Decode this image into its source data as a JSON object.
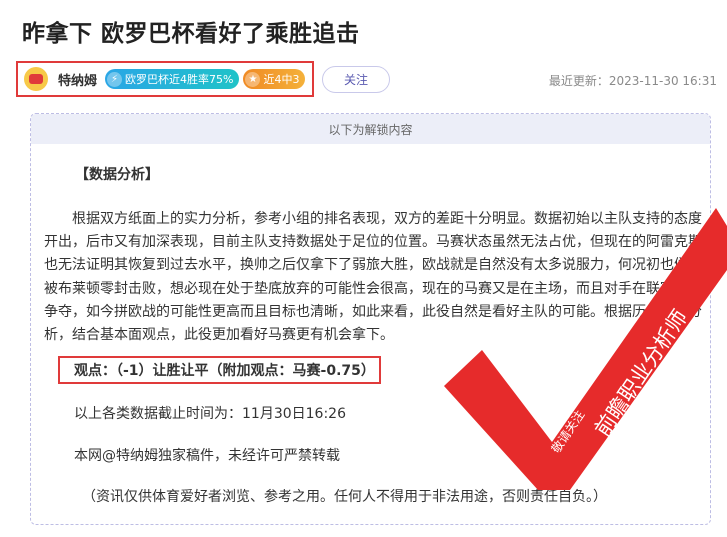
{
  "article": {
    "title": "昨拿下 欧罗巴杯看好了乘胜追击",
    "update_label": "最近更新",
    "update_time": "2023-11-30 16:31"
  },
  "author": {
    "name": "特纳姆",
    "badge_winrate": "欧罗巴杯近4胜率75%",
    "badge_streak": "近4中3",
    "follow_label": "关注"
  },
  "unlock": {
    "header": "以下为解锁内容"
  },
  "body": {
    "section_title": "【数据分析】",
    "paragraph": "根据双方纸面上的实力分析，参考小组的排名表现，双方的差距十分明显。数据初始以主队支持的态度开出，后市又有加深表现，目前主队支持数据处于足位的位置。马赛状态虽然无法占优，但现在的阿雷克斯也无法证明其恢复到过去水平，换帅之后仅拿下了弱旅大胜，欧战就是自然没有太多说服力，何况初也们就被布莱顿零封击败，想必现在处于垫底放弃的可能性会很高，现在的马赛又是在主场，而且对手在联赛还能争夺，如今拼欧战的可能性更高而且目标也清晰，如此来看，此役自然是看好主队的可能。根据历史数据分析，结合基本面观点，此役更加看好马赛更有机会拿下。",
    "viewpoint": "观点：（-1）让胜让平（附加观点：马赛-0.75）",
    "data_deadline": "以上各类数据截止时间为：11月30日16:26",
    "copyright": "本网@特纳姆独家稿件，未经许可严禁转载",
    "disclaimer": "（资讯仅供体育爱好者浏览、参考之用。任何人不得用于非法用途，否则责任自负。）"
  },
  "stamp": {
    "text_main": "前瞻职业分析师",
    "text_small": "敬请关注"
  },
  "colors": {
    "accent_red": "#e03a3a",
    "badge_blue": "#2aa6e6",
    "badge_orange": "#f08a24",
    "header_bg": "#eceef8"
  }
}
